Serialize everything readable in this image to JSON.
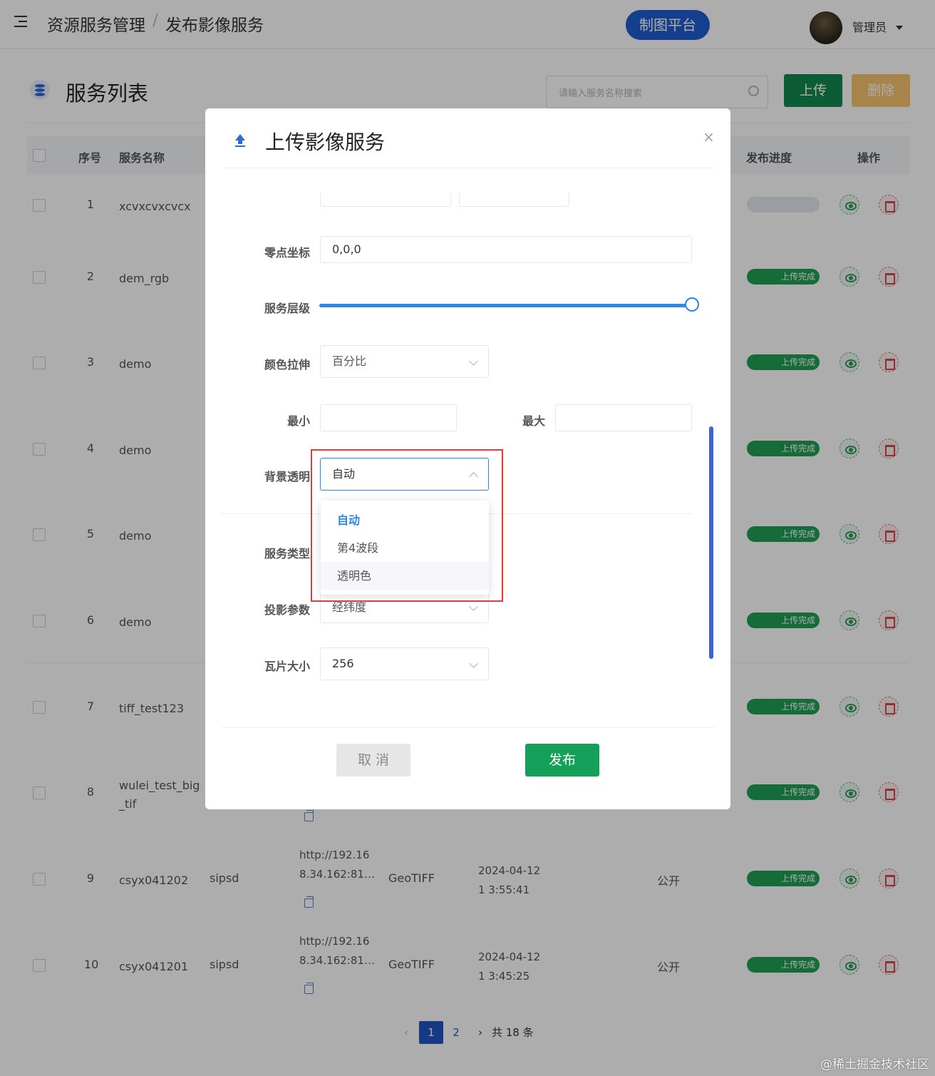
{
  "header": {
    "breadcrumb": [
      "资源服务管理",
      "发布影像服务"
    ],
    "separator": "/",
    "platform_button": "制图平台",
    "user_name": "管理员"
  },
  "panel": {
    "title": "服务列表",
    "search_placeholder": "请输入服务名称搜索",
    "upload_label": "上传",
    "delete_label": "删除",
    "columns": [
      "序号",
      "服务名称",
      "发布进度",
      "操作"
    ],
    "rows": [
      {
        "index": "1",
        "name": "xcvxcvxcvcx",
        "progress": ""
      },
      {
        "index": "2",
        "name": "dem_rgb",
        "progress": "上传完成"
      },
      {
        "index": "3",
        "name": "demo",
        "progress": "上传完成"
      },
      {
        "index": "4",
        "name": "demo",
        "progress": "上传完成"
      },
      {
        "index": "5",
        "name": "demo",
        "progress": "上传完成"
      },
      {
        "index": "6",
        "name": "demo",
        "progress": "上传完成"
      },
      {
        "index": "7",
        "name": "tiff_test123",
        "progress": "上传完成"
      },
      {
        "index": "8",
        "name": "wulei_test_big _tif",
        "progress": "上传完成"
      },
      {
        "index": "9",
        "name": "csyx041202",
        "owner": "sipsd",
        "url": "http://192.16 8.34.162:81…",
        "format": "GeoTIFF",
        "time": "2024-04-12 1 3:55:41",
        "access": "公开",
        "progress": "上传完成"
      },
      {
        "index": "10",
        "name": "csyx041201",
        "owner": "sipsd",
        "url": "http://192.16 8.34.162:81…",
        "format": "GeoTIFF",
        "time": "2024-04-12 1 3:45:25",
        "access": "公开",
        "progress": "上传完成"
      }
    ],
    "pagination": {
      "prev": "‹",
      "pages": [
        "1",
        "2"
      ],
      "next": "›",
      "total": "共 18 条"
    }
  },
  "modal": {
    "title": "上传影像服务",
    "close": "×",
    "fields": {
      "origin": {
        "label": "零点坐标",
        "value": "0,0,0"
      },
      "level": {
        "label": "服务层级",
        "fill_percent": 100
      },
      "stretch": {
        "label": "颜色拉伸",
        "value": "百分比"
      },
      "min": {
        "label": "最小",
        "value": ""
      },
      "max": {
        "label": "最大",
        "value": ""
      },
      "bg": {
        "label": "背景透明",
        "value": "自动",
        "options": [
          "自动",
          "第4波段",
          "透明色"
        ]
      },
      "service_type": {
        "label": "服务类型"
      },
      "projection": {
        "label": "投影参数",
        "value": "经纬度"
      },
      "tile": {
        "label": "瓦片大小",
        "value": "256"
      }
    },
    "cancel_label": "取 消",
    "publish_label": "发布"
  },
  "watermark": "@稀土掘金技术社区",
  "colors": {
    "accent": "#2f86e6",
    "primary_green": "#15a05a",
    "highlight": "#e23b3b",
    "brand": "#1f5ecf"
  }
}
